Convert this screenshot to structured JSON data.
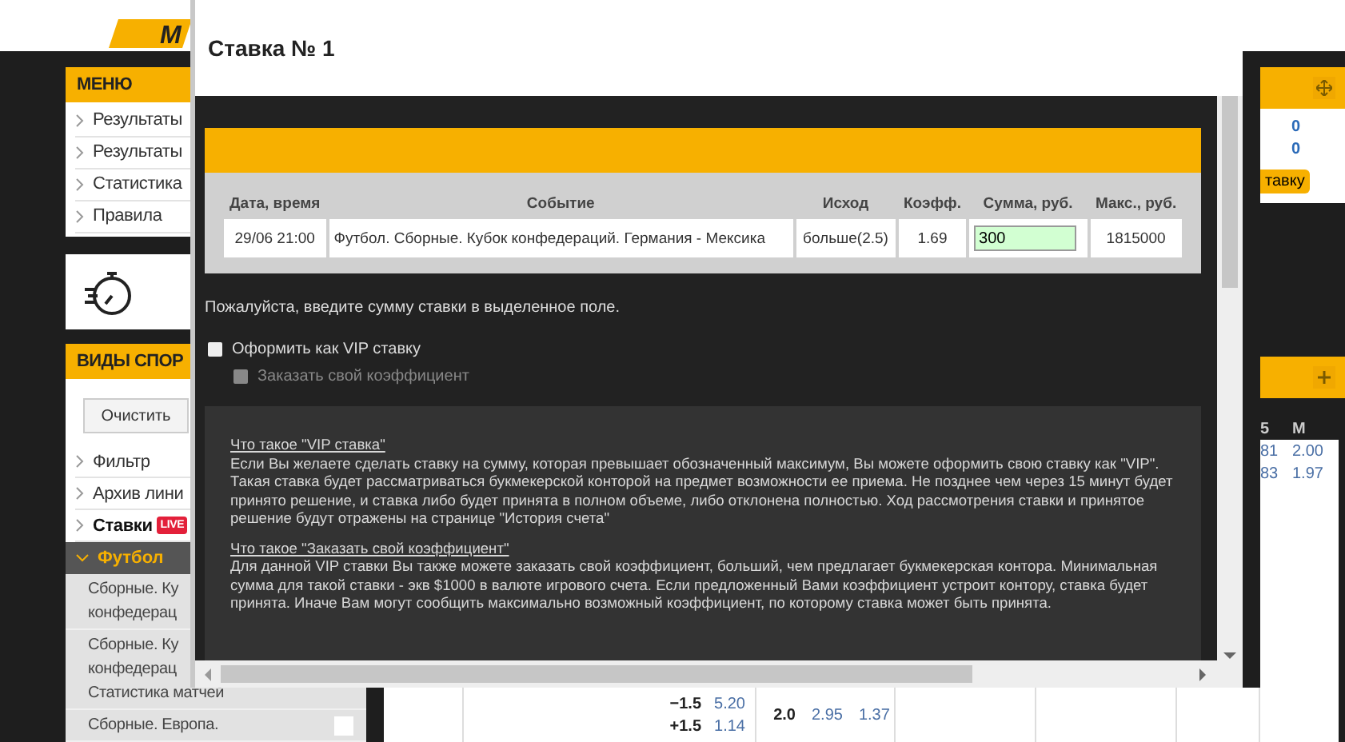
{
  "header": {
    "logo_text": "M"
  },
  "menu": {
    "title": "МЕНЮ",
    "items": [
      "Результаты",
      "Результаты",
      "Статистика",
      "Правила"
    ]
  },
  "sports": {
    "title": "ВИДЫ СПОР",
    "clear_button": "Очистить",
    "items": [
      {
        "label": "Фильтр"
      },
      {
        "label": "Архив лини"
      },
      {
        "label": "Ставки",
        "badge": "LIVE"
      }
    ],
    "category": {
      "label": "Футбол",
      "expanded": true
    },
    "subitems": [
      {
        "lines": [
          "Сборные. Ку",
          "конфедерац"
        ]
      },
      {
        "lines": [
          "Сборные. Ку",
          "конфедерац",
          "Статистика матчей"
        ]
      },
      {
        "lines": [
          "Сборные. Европа."
        ],
        "checked": false
      }
    ]
  },
  "odds_rows": [
    {
      "handicap": "−1.5",
      "odd": "5.20"
    },
    {
      "handicap": "+1.5",
      "odd": "1.14"
    }
  ],
  "odds_total": [
    "2.0",
    "2.95",
    "1.37"
  ],
  "right_panel": {
    "values": [
      "0",
      "0"
    ],
    "button": "тавку",
    "table_columns": [
      "5",
      "M"
    ],
    "table_rows": [
      [
        "81",
        "2.00"
      ],
      [
        "83",
        "1.97"
      ]
    ]
  },
  "modal": {
    "title": "Ставка № 1",
    "table": {
      "columns": [
        "Дата, время",
        "Событие",
        "Исход",
        "Коэфф.",
        "Сумма, руб.",
        "Макс., руб."
      ],
      "row": {
        "datetime": "29/06 21:00",
        "event": "Футбол. Сборные. Кубок конфедераций. Германия - Мексика",
        "outcome": "больше(2.5)",
        "coef": "1.69",
        "amount": "300",
        "max": "1815000"
      }
    },
    "hint": "Пожалуйста, введите сумму ставки в выделенное поле.",
    "options": [
      {
        "label": "Оформить как VIP ставку",
        "checked": false,
        "disabled": false,
        "nested": false
      },
      {
        "label": "Заказать свой коэффициент",
        "checked": false,
        "disabled": true,
        "nested": true
      }
    ],
    "info": [
      {
        "heading": "Что такое \"VIP ставка\"",
        "text": "Если Вы желаете сделать ставку на сумму, которая превышает обозначенный максимум, Вы можете оформить свою ставку как \"VIP\". Такая ставка будет рассматриваться букмекерской конторой на предмет возможности ее приема. Не позднее чем через 15 минут будет принято решение, и ставка либо будет принята в полном объеме, либо отклонена полностью. Ход рассмотрения ставки и принятое решение будут отражены на странице \"История счета\""
      },
      {
        "heading": "Что такое \"Заказать свой коэффициент\"",
        "text": "Для данной VIP ставки Вы также можете заказать свой коэффициент, больший, чем предлагает букмекерская контора. Минимальная сумма для такой ставки - экв $1000 в валюте игрового счета. Если предложенный Вами коэффициент устроит контору, ставка будет принята. Иначе Вам могут сообщить максимально возможный коэффициент, по которому ставка может быть принята."
      }
    ]
  }
}
